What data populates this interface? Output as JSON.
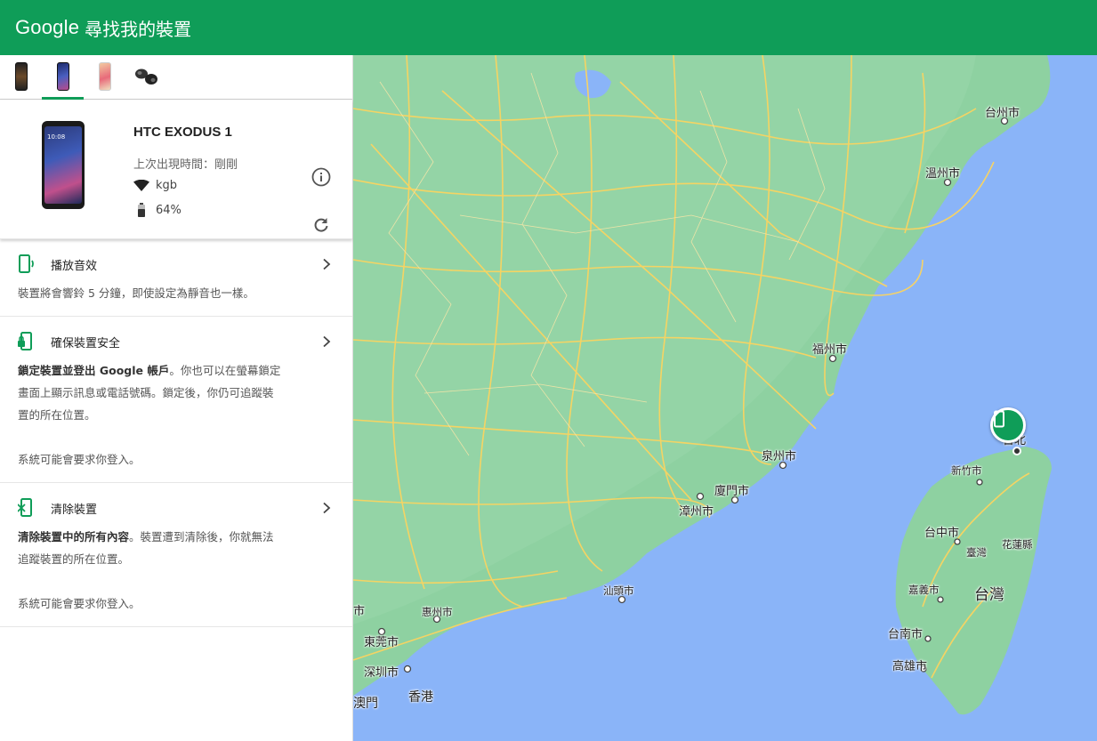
{
  "header": {
    "brand": "Google",
    "title": "尋找我的裝置"
  },
  "tabs": [
    {
      "name": "device-tab-1",
      "active": false
    },
    {
      "name": "device-tab-2",
      "active": true
    },
    {
      "name": "device-tab-3",
      "active": false
    },
    {
      "name": "device-tab-earbuds",
      "active": false
    }
  ],
  "device": {
    "name": "HTC EXODUS 1",
    "last_seen": "上次出現時間：剛剛",
    "wifi": "kgb",
    "battery": "64%",
    "screen_time": "10:08"
  },
  "actions": {
    "play_sound": {
      "title": "播放音效",
      "desc": "裝置將會響鈴 5 分鐘，即使設定為靜音也一樣。"
    },
    "secure": {
      "title": "確保裝置安全",
      "desc_bold": "鎖定裝置並登出 Google 帳戶",
      "desc_rest": "。你也可以在螢幕鎖定畫面上顯示訊息或電話號碼。鎖定後，你仍可追蹤裝置的所在位置。",
      "note": "系統可能會要求你登入。"
    },
    "erase": {
      "title": "清除裝置",
      "desc_bold": "清除裝置中的所有內容",
      "desc_rest": "。裝置遭到清除後，你就無法追蹤裝置的所在位置。",
      "note": "系統可能會要求你登入。"
    }
  },
  "map": {
    "labels": {
      "taizhou": "台州市",
      "wenzhou": "溫州市",
      "fuzhou": "福州市",
      "quanzhou": "泉州市",
      "xiamen": "廈門市",
      "zhangzhou": "漳州市",
      "shantou": "汕頭市",
      "huizhou": "惠州市",
      "dongguan": "東莞市",
      "shenzhen": "深圳市",
      "hongkong": "香港",
      "macau": "澳門",
      "taipei": "台北",
      "hsinchu": "新竹市",
      "taichung": "台中市",
      "taiwan_province": "臺灣",
      "hualien": "花蓮縣",
      "chiayi": "嘉義市",
      "taiwan": "台灣",
      "tainan": "台南市",
      "kaohsiung": "高雄市",
      "edge_city": "市"
    }
  },
  "colors": {
    "brand_green": "#0f9d58",
    "water": "#8ab4f8",
    "land": "#8ed1a1",
    "road": "#fbd460"
  }
}
